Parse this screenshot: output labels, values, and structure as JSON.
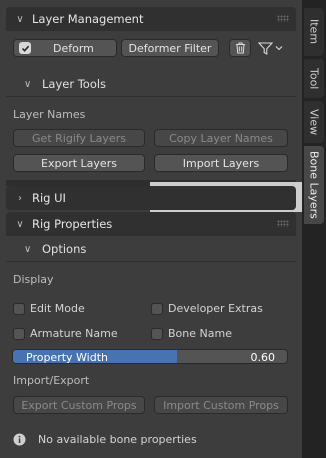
{
  "panels": {
    "layer_management": {
      "title": "Layer Management",
      "deform_label": "Deform",
      "deformer_filter_label": "Deformer Filter",
      "layer_tools": {
        "title": "Layer Tools",
        "layer_names_label": "Layer Names",
        "get_rigify_layers": "Get Rigify Layers",
        "copy_layer_names": "Copy Layer Names",
        "export_layers": "Export Layers",
        "import_layers": "Import Layers"
      }
    },
    "rig_ui": {
      "title": "Rig UI"
    },
    "rig_properties": {
      "title": "Rig Properties",
      "options": {
        "title": "Options",
        "display_label": "Display",
        "edit_mode": "Edit Mode",
        "developer_extras": "Developer Extras",
        "armature_name": "Armature Name",
        "bone_name": "Bone Name",
        "property_width_label": "Property Width",
        "property_width_value": "0.60",
        "property_width_fraction": 0.6,
        "import_export_label": "Import/Export",
        "export_custom_props": "Export Custom Props",
        "import_custom_props": "Import Custom Props",
        "info_message": "No available bone properties"
      }
    }
  },
  "sidebar_tabs": [
    {
      "label": "Item",
      "active": false
    },
    {
      "label": "Tool",
      "active": false
    },
    {
      "label": "View",
      "active": false
    },
    {
      "label": "Bone Layers",
      "active": true
    }
  ],
  "colors": {
    "accent": "#4772b3",
    "panel_bg": "#3d3d3d",
    "header_bg": "#303030"
  }
}
